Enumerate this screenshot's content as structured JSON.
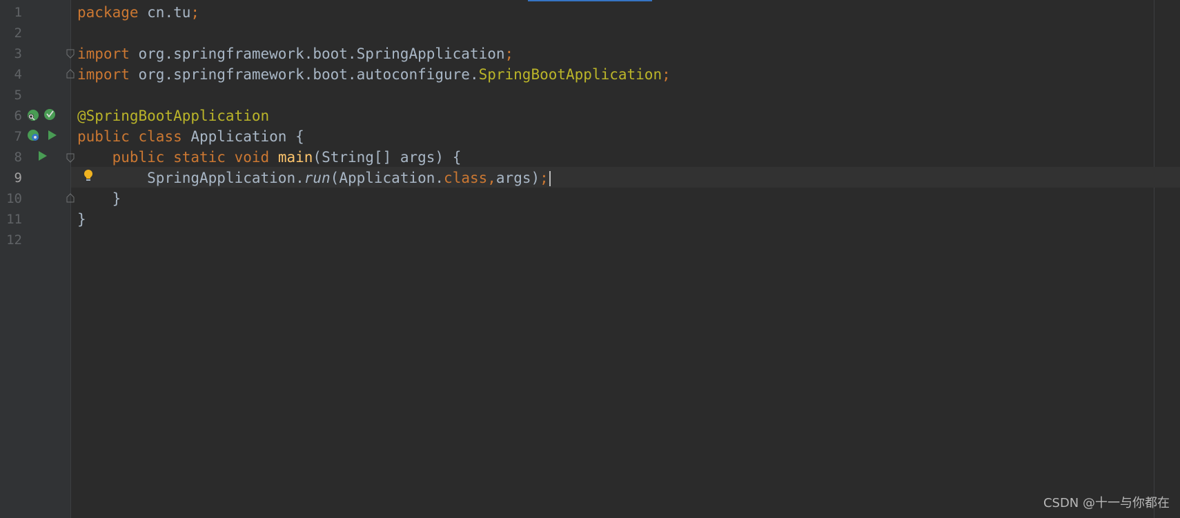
{
  "editor": {
    "current_line": 9,
    "line_numbers": [
      "1",
      "2",
      "3",
      "4",
      "5",
      "6",
      "7",
      "8",
      "9",
      "10",
      "11",
      "12"
    ],
    "lines": {
      "l1": {
        "kw": "package",
        "text": " cn.tu",
        "semi": ";"
      },
      "l3": {
        "kw": "import",
        "text": " org.springframework.boot.SpringApplication",
        "semi": ";"
      },
      "l4": {
        "kw": "import",
        "text": " org.springframework.boot.autoconfigure.",
        "cls": "SpringBootApplication",
        "semi": ";"
      },
      "l6": {
        "ann": "@SpringBootApplication"
      },
      "l7": {
        "kw1": "public",
        "kw2": "class",
        "text": " Application {"
      },
      "l8": {
        "indent": "    ",
        "kw1": "public",
        "kw2": "static",
        "kw3": "void",
        "fn": "main",
        "text": "(String[] args) {"
      },
      "l9": {
        "indent": "        ",
        "text1": "SpringApplication.",
        "method": "run",
        "text2": "(Application.",
        "kw": "class,",
        "text3": "args)",
        "semi": ";"
      },
      "l10": {
        "text": "    }"
      },
      "l11": {
        "text": "}"
      }
    }
  },
  "icons": {
    "spring_bean": "spring-bean-icon",
    "run": "run-icon",
    "intention_bulb": "intention-bulb-icon",
    "fold": "fold-icon"
  },
  "colors": {
    "background": "#2b2b2b",
    "keyword": "#cc7832",
    "annotation": "#bbb529",
    "function": "#ffc66d",
    "default_text": "#a9b7c6",
    "run_green": "#499c54",
    "bulb": "#f0b321"
  },
  "watermark": "CSDN @十一与你都在"
}
